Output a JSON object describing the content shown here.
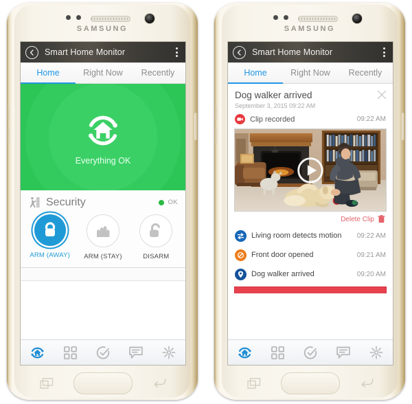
{
  "device": {
    "brand": "SAMSUNG"
  },
  "appbar": {
    "title": "Smart Home Monitor",
    "back_icon": "back-chevron-circle-icon",
    "menu_icon": "overflow-menu-icon"
  },
  "tabs": [
    {
      "label": "Home",
      "active": true
    },
    {
      "label": "Right Now",
      "active": false
    },
    {
      "label": "Recently",
      "active": false
    }
  ],
  "colors": {
    "accent_blue": "#2196e3",
    "status_green": "#25c04e",
    "arm_blue": "#1f9ad6",
    "alert_red": "#e8414e",
    "delete_red": "#e4636b",
    "event_blue": "#1667b8",
    "event_orange": "#ef7c1b",
    "event_navy": "#15539b"
  },
  "left_screen": {
    "hero": {
      "status_label": "Everything OK",
      "icon": "home-shield-refresh-icon"
    },
    "security": {
      "title": "Security",
      "icon": "person-exit-door-icon",
      "status_text": "OK",
      "status_dot_color": "#29b944",
      "modes": [
        {
          "label": "ARM (AWAY)",
          "icon": "padlock-closed-icon",
          "selected": true
        },
        {
          "label": "ARM (STAY)",
          "icon": "house-walls-icon",
          "selected": false
        },
        {
          "label": "DISARM",
          "icon": "padlock-open-icon",
          "selected": false
        }
      ]
    }
  },
  "right_screen": {
    "event": {
      "title": "Dog walker arrived",
      "subtitle": "September 3, 2015 09:22 AM",
      "close_icon": "close-x-icon",
      "clip_label": "Clip recorded",
      "clip_icon": "video-camera-icon",
      "clip_time": "09:22 AM",
      "video_play_icon": "play-button-icon",
      "delete_label": "Delete Clip",
      "delete_icon": "trash-can-icon"
    },
    "activity": [
      {
        "label": "Living room detects motion",
        "time": "09:22 AM",
        "icon": "motion-sensor-icon",
        "color": "blue"
      },
      {
        "label": "Front door opened",
        "time": "09:21 AM",
        "icon": "door-open-icon",
        "color": "orange"
      },
      {
        "label": "Dog walker arrived",
        "time": "09:20 AM",
        "icon": "location-pin-icon",
        "color": "navy"
      }
    ]
  },
  "bottom_nav": [
    {
      "icon": "home-monitor-icon",
      "active": true
    },
    {
      "icon": "grid-tiles-icon",
      "active": false
    },
    {
      "icon": "check-circle-icon",
      "active": false
    },
    {
      "icon": "message-bubble-icon",
      "active": false
    },
    {
      "icon": "sun-burst-icon",
      "active": false
    }
  ],
  "nav_keys": {
    "recents_icon": "recents-icon",
    "home_icon": "home-key",
    "back_icon": "back-key-icon"
  }
}
